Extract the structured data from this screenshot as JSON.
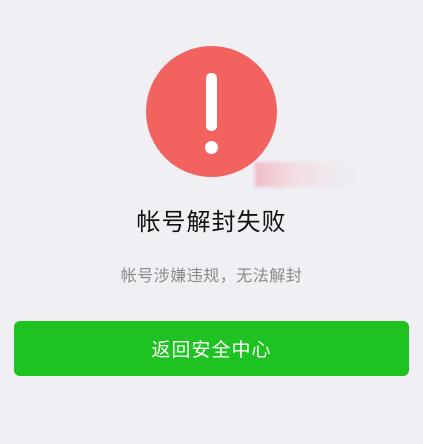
{
  "status": {
    "icon": "exclamation-icon",
    "color": "#f26360"
  },
  "title": "帐号解封失败",
  "message": "帐号涉嫌违规，无法解封",
  "actions": {
    "primary_label": "返回安全中心",
    "primary_color": "#1ec221"
  }
}
